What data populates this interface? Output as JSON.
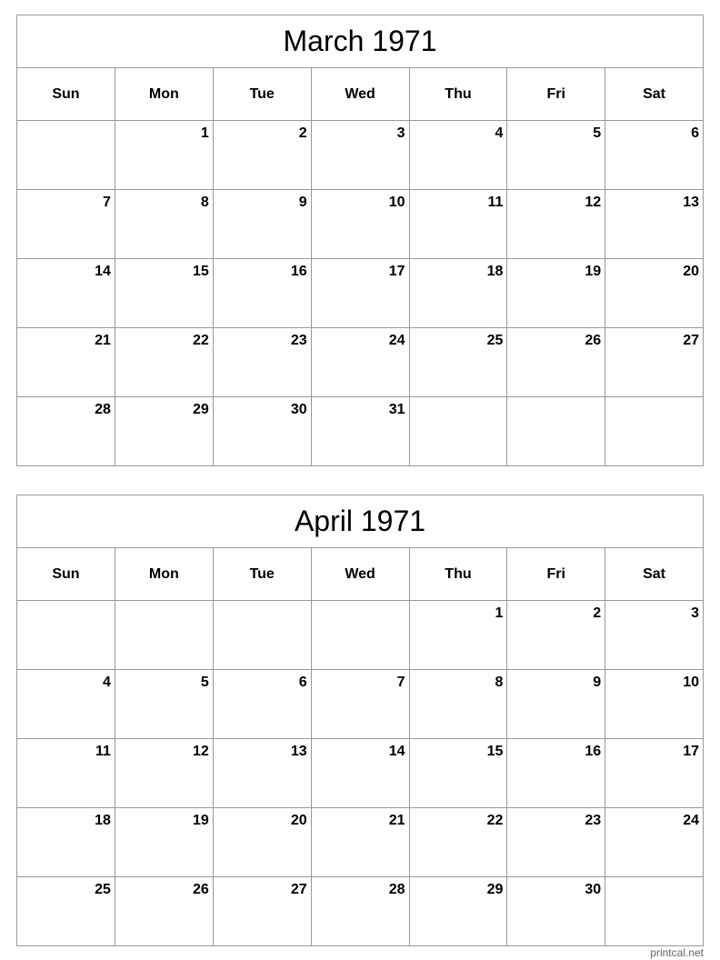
{
  "weekdays": [
    "Sun",
    "Mon",
    "Tue",
    "Wed",
    "Thu",
    "Fri",
    "Sat"
  ],
  "months": [
    {
      "title": "March 1971",
      "weeks": [
        [
          "",
          "1",
          "2",
          "3",
          "4",
          "5",
          "6"
        ],
        [
          "7",
          "8",
          "9",
          "10",
          "11",
          "12",
          "13"
        ],
        [
          "14",
          "15",
          "16",
          "17",
          "18",
          "19",
          "20"
        ],
        [
          "21",
          "22",
          "23",
          "24",
          "25",
          "26",
          "27"
        ],
        [
          "28",
          "29",
          "30",
          "31",
          "",
          "",
          ""
        ]
      ]
    },
    {
      "title": "April 1971",
      "weeks": [
        [
          "",
          "",
          "",
          "",
          "1",
          "2",
          "3"
        ],
        [
          "4",
          "5",
          "6",
          "7",
          "8",
          "9",
          "10"
        ],
        [
          "11",
          "12",
          "13",
          "14",
          "15",
          "16",
          "17"
        ],
        [
          "18",
          "19",
          "20",
          "21",
          "22",
          "23",
          "24"
        ],
        [
          "25",
          "26",
          "27",
          "28",
          "29",
          "30",
          ""
        ]
      ]
    }
  ],
  "credit": "printcal.net"
}
